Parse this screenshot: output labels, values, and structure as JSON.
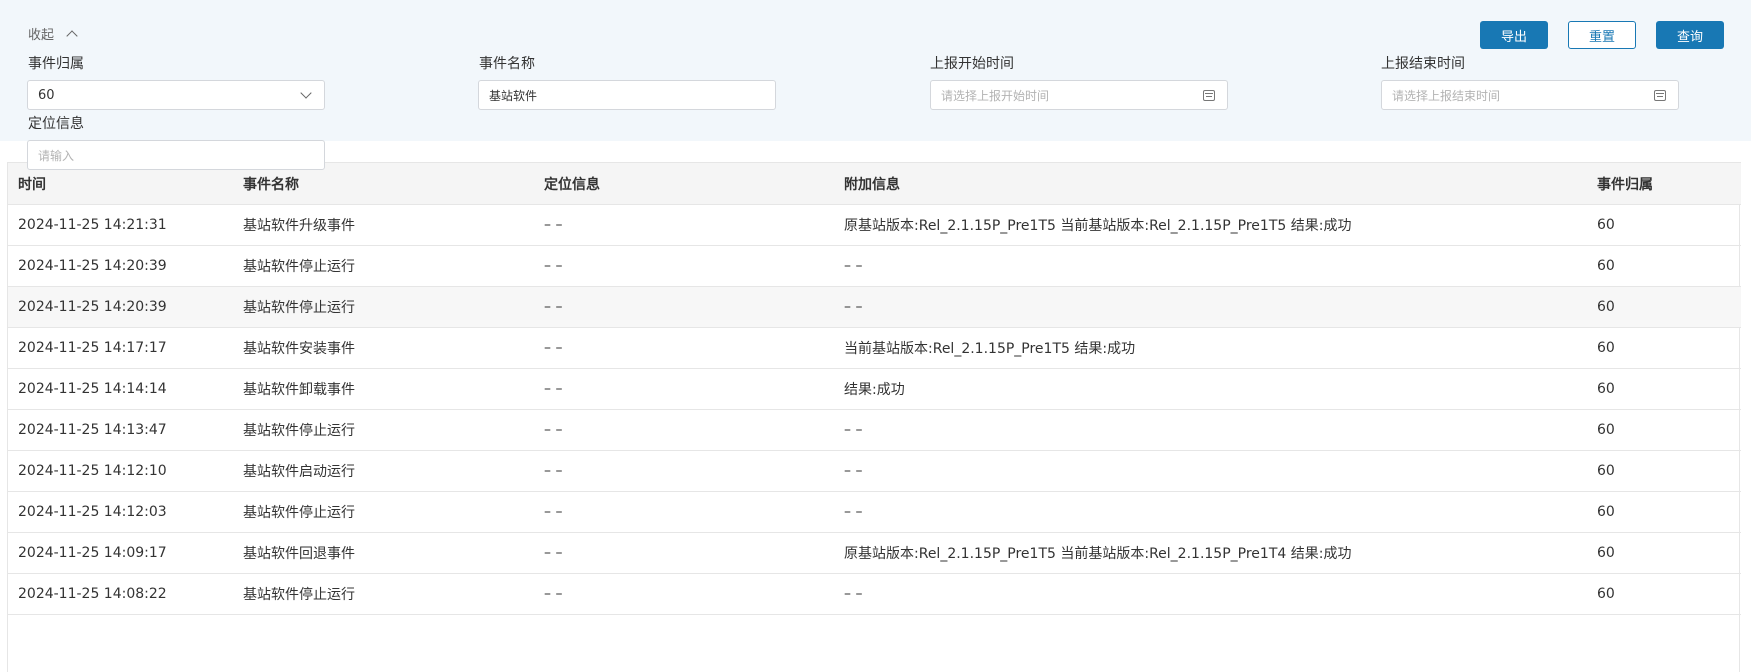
{
  "filters": {
    "collapse_label": "收起",
    "export_label": "导出",
    "reset_label": "重置",
    "query_label": "查询",
    "event_owner": {
      "label": "事件归属",
      "value": "60"
    },
    "event_name": {
      "label": "事件名称",
      "value": "基站软件"
    },
    "report_start": {
      "label": "上报开始时间",
      "placeholder": "请选择上报开始时间"
    },
    "report_end": {
      "label": "上报结束时间",
      "placeholder": "请选择上报结束时间"
    },
    "location": {
      "label": "定位信息",
      "placeholder": "请输入"
    }
  },
  "table": {
    "columns": [
      "时间",
      "事件名称",
      "定位信息",
      "附加信息",
      "事件归属"
    ],
    "rows": [
      [
        "2024-11-25 14:21:31",
        "基站软件升级事件",
        "– –",
        "原基站版本:Rel_2.1.15P_Pre1T5 当前基站版本:Rel_2.1.15P_Pre1T5 结果:成功",
        "60"
      ],
      [
        "2024-11-25 14:20:39",
        "基站软件停止运行",
        "– –",
        "– –",
        "60"
      ],
      [
        "2024-11-25 14:20:39",
        "基站软件停止运行",
        "– –",
        "– –",
        "60"
      ],
      [
        "2024-11-25 14:17:17",
        "基站软件安装事件",
        "– –",
        "当前基站版本:Rel_2.1.15P_Pre1T5 结果:成功",
        "60"
      ],
      [
        "2024-11-25 14:14:14",
        "基站软件卸载事件",
        "– –",
        "结果:成功",
        "60"
      ],
      [
        "2024-11-25 14:13:47",
        "基站软件停止运行",
        "– –",
        "– –",
        "60"
      ],
      [
        "2024-11-25 14:12:10",
        "基站软件启动运行",
        "– –",
        "– –",
        "60"
      ],
      [
        "2024-11-25 14:12:03",
        "基站软件停止运行",
        "– –",
        "– –",
        "60"
      ],
      [
        "2024-11-25 14:09:17",
        "基站软件回退事件",
        "– –",
        "原基站版本:Rel_2.1.15P_Pre1T5 当前基站版本:Rel_2.1.15P_Pre1T4 结果:成功",
        "60"
      ],
      [
        "2024-11-25 14:08:22",
        "基站软件停止运行",
        "– –",
        "– –",
        "60"
      ]
    ]
  }
}
